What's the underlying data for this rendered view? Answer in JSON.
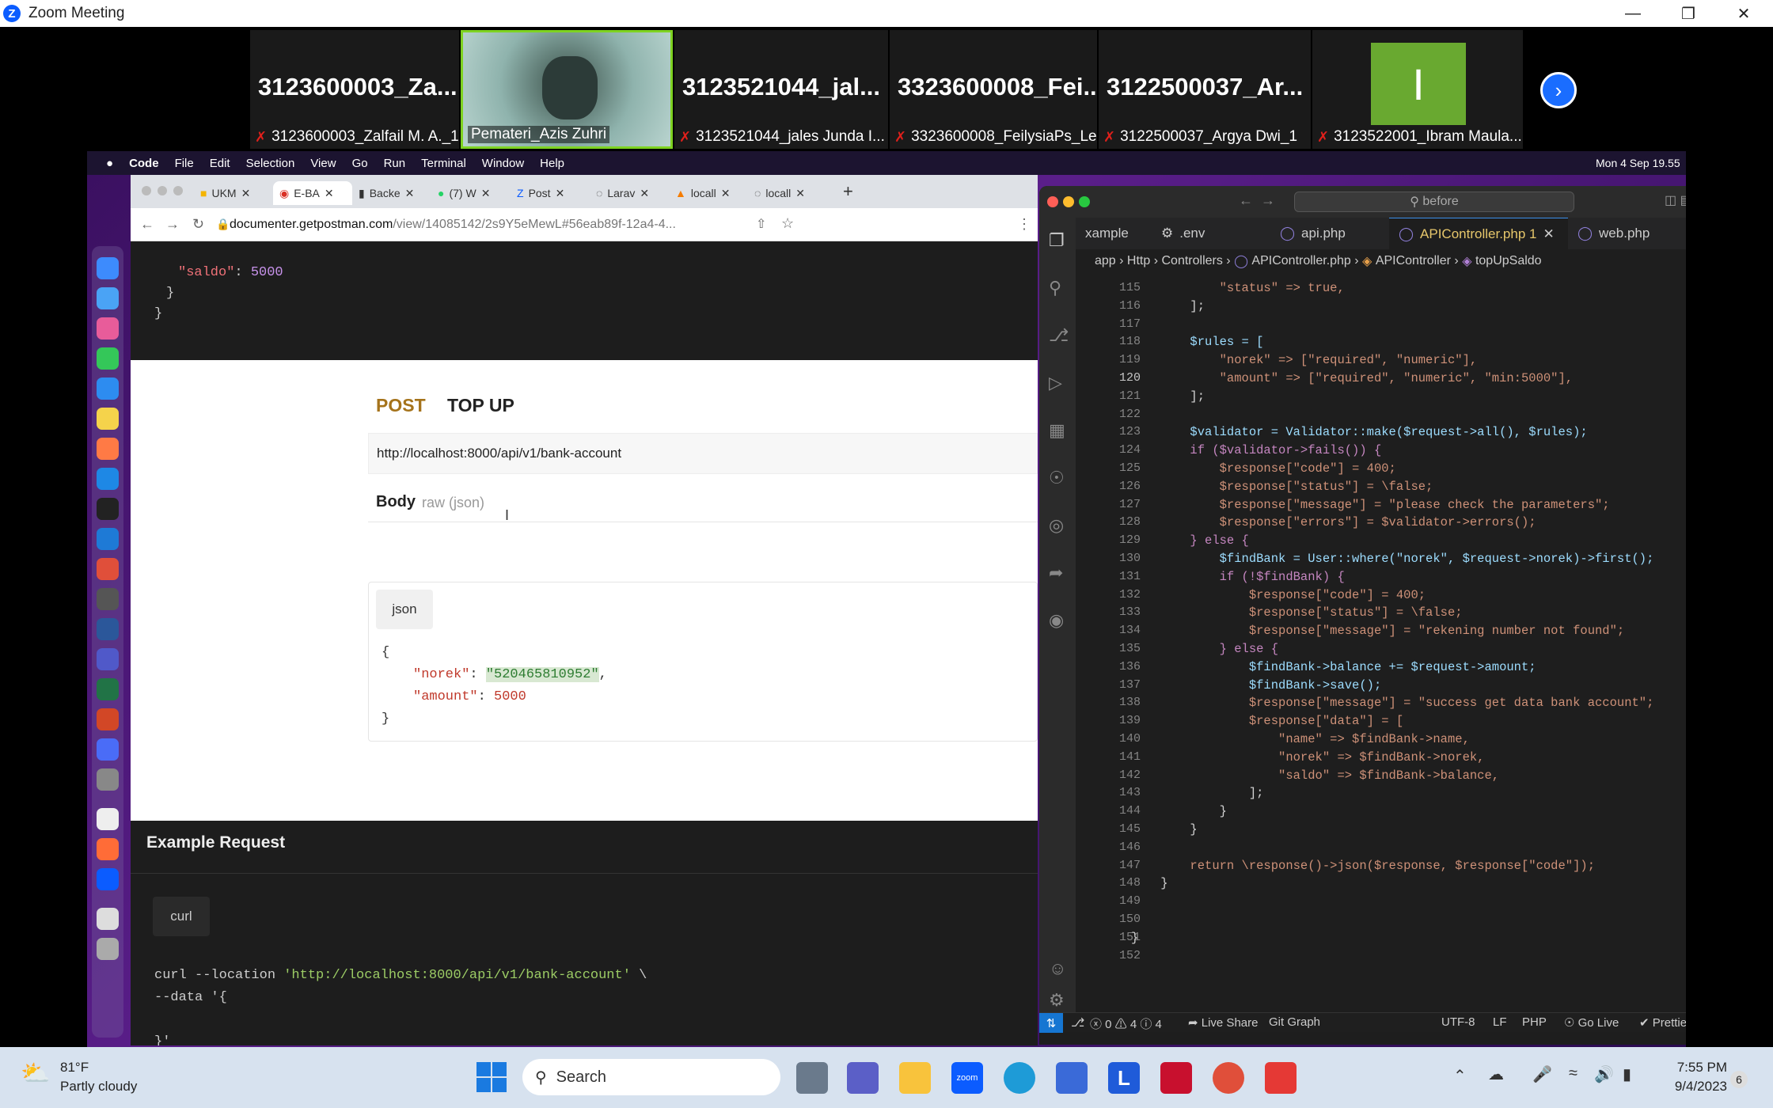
{
  "zoom": {
    "title": "Zoom Meeting"
  },
  "participants": [
    {
      "name": "3123600003_Za...",
      "label": "3123600003_Zalfail M. A._1"
    },
    {
      "name": "",
      "label": "Pemateri_Azis Zuhri"
    },
    {
      "name": "3123521044_jal...",
      "label": "3123521044_jales Junda I..."
    },
    {
      "name": "3323600008_Fei...",
      "label": "3323600008_FeilysiaPs_Le..."
    },
    {
      "name": "3122500037_Ar...",
      "label": "3122500037_Argya Dwi_1"
    },
    {
      "name": "I",
      "label": "3123522001_Ibram Maula..."
    }
  ],
  "mac": {
    "menus": [
      "Code",
      "File",
      "Edit",
      "Selection",
      "View",
      "Go",
      "Run",
      "Terminal",
      "Window",
      "Help"
    ],
    "clock": "Mon 4 Sep  19.55"
  },
  "browser": {
    "tabs": [
      "UKM",
      "E-BA",
      "Backe",
      "(7) W",
      "Post",
      "Larav",
      "locall",
      "locall"
    ],
    "url_domain": "documenter.getpostman.com",
    "url_path": "/view/14085142/2s9Y5eMewL#56eab89f-12a4-4...",
    "top_code": {
      "key": "\"saldo\"",
      "value": "5000",
      "close1": "}",
      "close2": "}"
    },
    "doc": {
      "method": "POST",
      "title": "TOP UP",
      "endpoint": "http://localhost:8000/api/v1/bank-account",
      "body_label": "Body",
      "body_type": "raw (json)",
      "json_tab": "json",
      "json_lines": {
        "open": "{",
        "norek_key": "\"norek\"",
        "norek_val": "\"520465810952\"",
        "amount_key": "\"amount\"",
        "amount_val": "5000",
        "close": "}"
      }
    },
    "example": {
      "title": "Example Request",
      "tab": "curl",
      "line1_cmd": "curl --location",
      "line1_url": "'http://localhost:8000/api/v1/bank-account'",
      "line1_end": " \\",
      "line2": "--data '{",
      "line3": "}'"
    }
  },
  "vscode": {
    "search": "before",
    "tabs": [
      "xample",
      ".env",
      "api.php",
      "APIController.php 1",
      "web.php"
    ],
    "breadcrumb": [
      "app",
      "Http",
      "Controllers",
      "APIController.php",
      "APIController",
      "topUpSaldo"
    ],
    "lines": [
      {
        "n": "115",
        "t": "            \"status\" => true,"
      },
      {
        "n": "116",
        "t": "        ];"
      },
      {
        "n": "117",
        "t": ""
      },
      {
        "n": "118",
        "t": "        $rules = ["
      },
      {
        "n": "119",
        "t": "            \"norek\" => [\"required\", \"numeric\"],"
      },
      {
        "n": "120",
        "t": "            \"amount\" => [\"required\", \"numeric\", \"min:5000\"],"
      },
      {
        "n": "121",
        "t": "        ];"
      },
      {
        "n": "122",
        "t": ""
      },
      {
        "n": "123",
        "t": "        $validator = Validator::make($request->all(), $rules);"
      },
      {
        "n": "124",
        "t": "        if ($validator->fails()) {"
      },
      {
        "n": "125",
        "t": "            $response[\"code\"] = 400;"
      },
      {
        "n": "126",
        "t": "            $response[\"status\"] = \\false;"
      },
      {
        "n": "127",
        "t": "            $response[\"message\"] = \"please check the parameters\";"
      },
      {
        "n": "128",
        "t": "            $response[\"errors\"] = $validator->errors();"
      },
      {
        "n": "129",
        "t": "        } else {"
      },
      {
        "n": "130",
        "t": "            $findBank = User::where(\"norek\", $request->norek)->first();"
      },
      {
        "n": "131",
        "t": "            if (!$findBank) {"
      },
      {
        "n": "132",
        "t": "                $response[\"code\"] = 400;"
      },
      {
        "n": "133",
        "t": "                $response[\"status\"] = \\false;"
      },
      {
        "n": "134",
        "t": "                $response[\"message\"] = \"rekening number not found\";"
      },
      {
        "n": "135",
        "t": "            } else {"
      },
      {
        "n": "136",
        "t": "                $findBank->balance += $request->amount;"
      },
      {
        "n": "137",
        "t": "                $findBank->save();"
      },
      {
        "n": "138",
        "t": "                $response[\"message\"] = \"success get data bank account\";"
      },
      {
        "n": "139",
        "t": "                $response[\"data\"] = ["
      },
      {
        "n": "140",
        "t": "                    \"name\" => $findBank->name,"
      },
      {
        "n": "141",
        "t": "                    \"norek\" => $findBank->norek,"
      },
      {
        "n": "142",
        "t": "                    \"saldo\" => $findBank->balance,"
      },
      {
        "n": "143",
        "t": "                ];"
      },
      {
        "n": "144",
        "t": "            }"
      },
      {
        "n": "145",
        "t": "        }"
      },
      {
        "n": "146",
        "t": ""
      },
      {
        "n": "147",
        "t": "        return \\response()->json($response, $response[\"code\"]);"
      },
      {
        "n": "148",
        "t": "    }"
      },
      {
        "n": "149",
        "t": ""
      },
      {
        "n": "150",
        "t": ""
      },
      {
        "n": "151",
        "t": "}"
      },
      {
        "n": "152",
        "t": ""
      }
    ],
    "status": {
      "problems": "ⓧ 0 ⚠ 4 ⓘ 4",
      "live_share": "Live Share",
      "git_graph": "Git Graph",
      "encoding": "UTF-8",
      "eol": "LF",
      "lang": "PHP",
      "go_live": "Go Live",
      "prettier": "Prettier"
    }
  },
  "taskbar": {
    "weather_temp": "81°F",
    "weather_desc": "Partly cloudy",
    "search": "Search",
    "time": "7:55 PM",
    "date": "9/4/2023",
    "notif": "6"
  }
}
